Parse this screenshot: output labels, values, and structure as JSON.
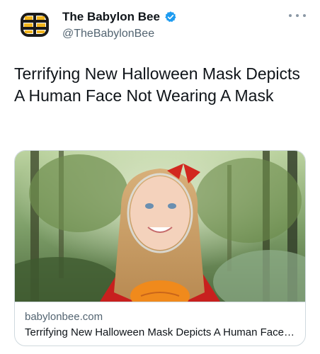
{
  "author": {
    "display_name": "The Babylon Bee",
    "handle": "@TheBabylonBee",
    "verified": true,
    "avatar_icon": "bee-logo-icon",
    "verified_icon": "verified-badge-icon"
  },
  "tweet": {
    "text": "Terrifying New Halloween Mask Depicts A Human Face Not Wearing A Mask"
  },
  "link_card": {
    "domain": "babylonbee.com",
    "title": "Terrifying New Halloween Mask Depicts A Human Face Not Wearing A Mask",
    "image_description_icon": "article-photo"
  },
  "colors": {
    "text_primary": "#0f1419",
    "text_secondary": "#536471",
    "verified_blue": "#1d9bf0",
    "border": "#cfd9de"
  }
}
